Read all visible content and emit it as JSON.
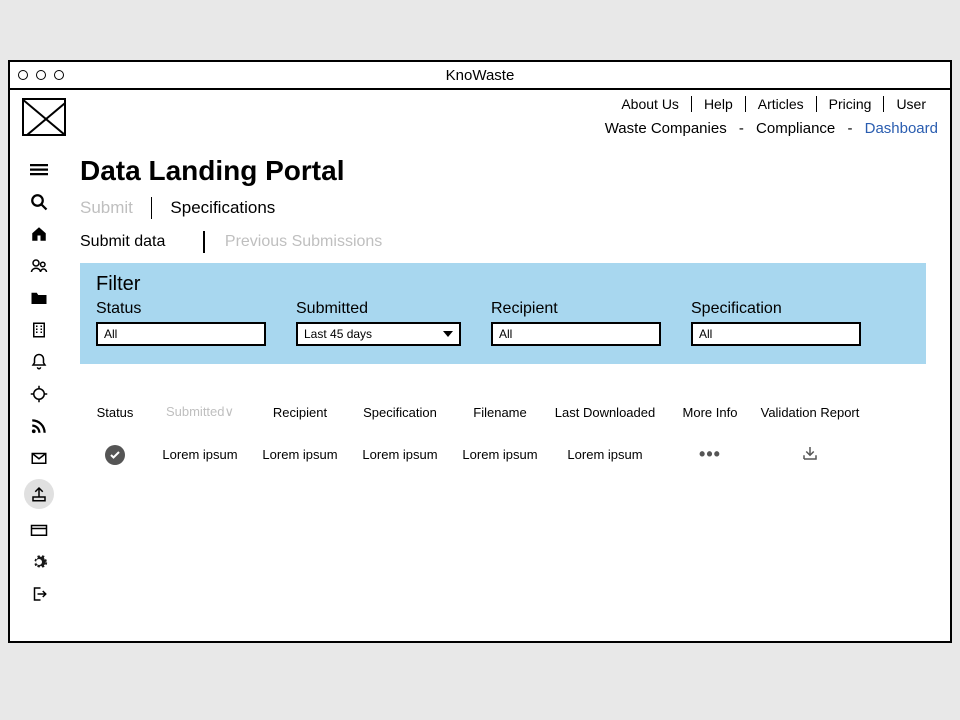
{
  "window_title": "KnoWaste",
  "topnav": [
    "About Us",
    "Help",
    "Articles",
    "Pricing",
    "User"
  ],
  "breadcrumb": {
    "items": [
      "Waste Companies",
      "Compliance",
      "Dashboard"
    ],
    "active_index": 2
  },
  "page_title": "Data Landing Portal",
  "primary_tabs": {
    "items": [
      "Submit",
      "Specifications"
    ],
    "active_index": 1,
    "muted_index": 0
  },
  "secondary_tabs": {
    "items": [
      "Submit data",
      "Previous Submissions"
    ],
    "active_index": 0,
    "muted_index": 1
  },
  "filter": {
    "title": "Filter",
    "status": {
      "label": "Status",
      "value": "All"
    },
    "submitted": {
      "label": "Submitted",
      "value": "Last 45 days"
    },
    "recipient": {
      "label": "Recipient",
      "value": "All"
    },
    "specification": {
      "label": "Specification",
      "value": "All"
    }
  },
  "table": {
    "headers": [
      "Status",
      "Submitted∨",
      "Recipient",
      "Specification",
      "Filename",
      "Last Downloaded",
      "More Info",
      "Validation Report"
    ],
    "sorted_muted_index": 1,
    "rows": [
      {
        "status": "ok",
        "submitted": "Lorem ipsum",
        "recipient": "Lorem ipsum",
        "specification": "Lorem ipsum",
        "filename": "Lorem ipsum",
        "last_downloaded": "Lorem ipsum"
      }
    ]
  },
  "sidebar_icons": [
    "menu",
    "search",
    "home",
    "users",
    "folder",
    "building",
    "bell",
    "target",
    "rss",
    "mail",
    "upload",
    "card",
    "gear",
    "logout"
  ],
  "sidebar_active": "upload"
}
